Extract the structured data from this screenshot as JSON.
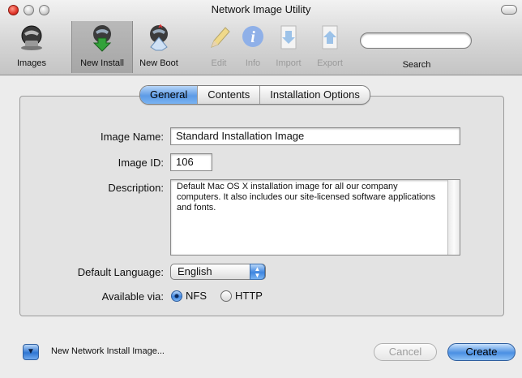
{
  "window": {
    "title": "Network Image Utility"
  },
  "toolbar": {
    "items": [
      {
        "label": "Images",
        "icon": "images-icon",
        "selected": false,
        "enabled": true
      },
      {
        "label": "New Install",
        "icon": "new-install-icon",
        "selected": true,
        "enabled": true
      },
      {
        "label": "New Boot",
        "icon": "new-boot-icon",
        "selected": false,
        "enabled": true
      },
      {
        "label": "Edit",
        "icon": "pencil-icon",
        "selected": false,
        "enabled": false
      },
      {
        "label": "Info",
        "icon": "info-icon",
        "selected": false,
        "enabled": false
      },
      {
        "label": "Import",
        "icon": "import-icon",
        "selected": false,
        "enabled": false
      },
      {
        "label": "Export",
        "icon": "export-icon",
        "selected": false,
        "enabled": false
      }
    ],
    "search": {
      "label": "Search",
      "value": ""
    }
  },
  "tabs": [
    {
      "label": "General",
      "active": true
    },
    {
      "label": "Contents",
      "active": false
    },
    {
      "label": "Installation Options",
      "active": false
    }
  ],
  "form": {
    "image_name_label": "Image Name:",
    "image_name_value": "Standard Installation Image",
    "image_id_label": "Image ID:",
    "image_id_value": "106",
    "description_label": "Description:",
    "description_value": "Default Mac OS X installation image for all our company computers. It also includes our site-licensed software applications and fonts.",
    "language_label": "Default Language:",
    "language_value": "English",
    "available_label": "Available via:",
    "protocols": [
      {
        "label": "NFS",
        "selected": true
      },
      {
        "label": "HTTP",
        "selected": false
      }
    ]
  },
  "footer": {
    "status_text": "New Network Install Image...",
    "cancel_label": "Cancel",
    "create_label": "Create"
  },
  "colors": {
    "accent": "#4a8fe3",
    "window_bg": "#ececec"
  }
}
